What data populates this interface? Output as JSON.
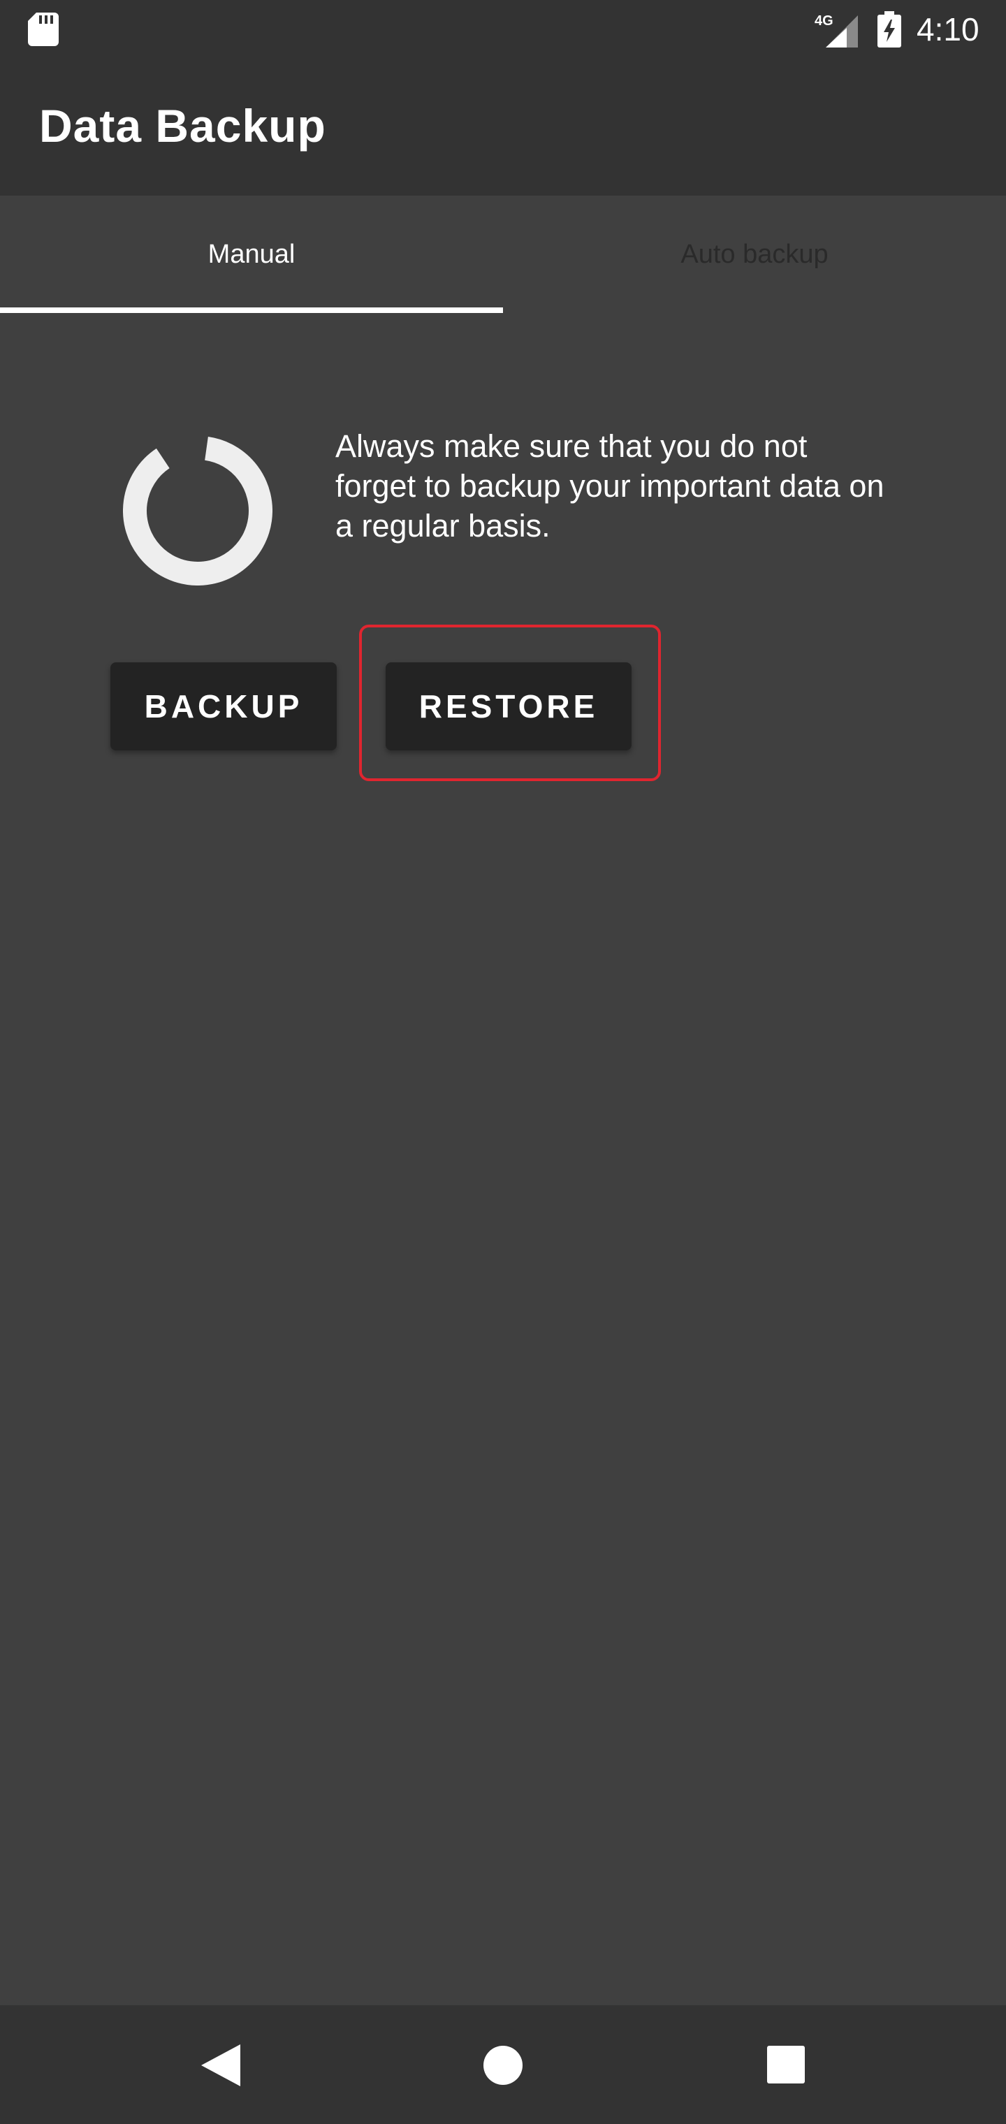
{
  "status_bar": {
    "time": "4:10",
    "network": "4G",
    "icons": [
      "sd-card-icon",
      "signal-icon",
      "battery-charging-icon"
    ]
  },
  "app_bar": {
    "title": "Data Backup"
  },
  "tabs": [
    {
      "label": "Manual",
      "selected": true
    },
    {
      "label": "Auto backup",
      "selected": false
    }
  ],
  "manual": {
    "icon": "ring-icon",
    "description": "Always make sure that you do not forget to backup your important data on a regular basis.",
    "backup_button": "BACKUP",
    "restore_button": "RESTORE"
  },
  "nav_bar": {
    "icons": [
      "back-icon",
      "home-icon",
      "recents-icon"
    ]
  },
  "colors": {
    "background": "#404040",
    "bars": "#333333",
    "button": "#232323",
    "highlight": "#e0252f"
  }
}
